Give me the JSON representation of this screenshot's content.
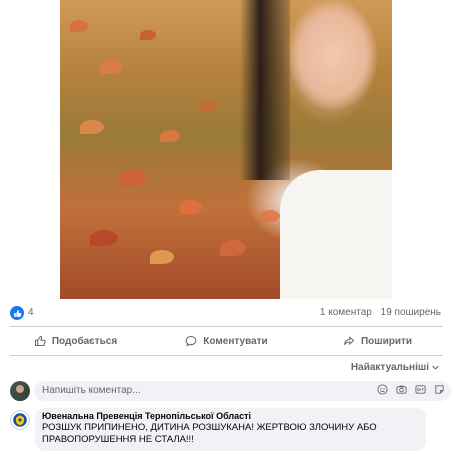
{
  "post": {
    "reactions_count": "4",
    "comments_count": "1 коментар",
    "shares_count": "19 поширень"
  },
  "actions": {
    "like_label": "Подобається",
    "comment_label": "Коментувати",
    "share_label": "Поширити"
  },
  "sort": {
    "label": "Найактуальніші"
  },
  "comment_input": {
    "placeholder": "Напишіть коментар..."
  },
  "comments": [
    {
      "author": "Ювенальна Превенція Тернопільської Області",
      "text": "РОЗШУК ПРИПИНЕНО, ДИТИНА РОЗШУКАНА! ЖЕРТВОЮ ЗЛОЧИНУ АБО ПРАВОПОРУШЕННЯ НЕ СТАЛА!!!"
    }
  ],
  "colors": {
    "accent": "#1877f2",
    "muted_text": "#65676b",
    "bubble_bg": "#f0f2f5"
  },
  "icons": {
    "like": "thumbs-up-icon",
    "comment": "speech-bubble-icon",
    "share": "share-arrow-icon",
    "emoji": "smiley-icon",
    "camera": "camera-icon",
    "gif": "gif-icon",
    "sticker": "sticker-icon"
  }
}
